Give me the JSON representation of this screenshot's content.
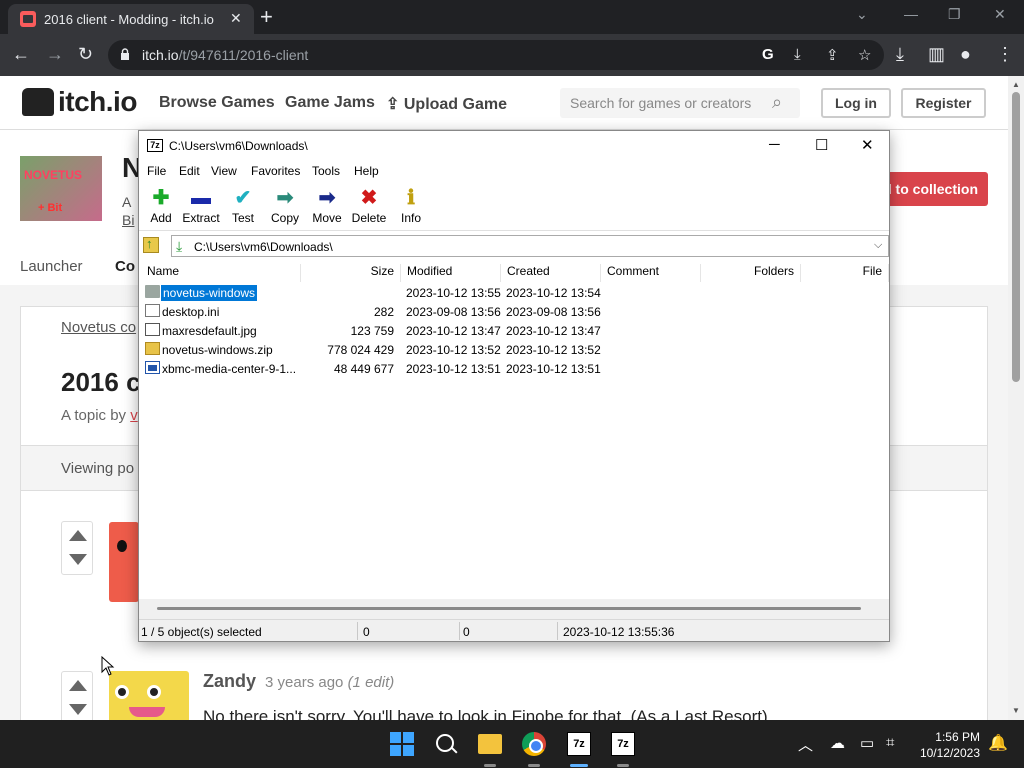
{
  "browser": {
    "tab_title": "2016 client - Modding - itch.io",
    "tab_close": "✕",
    "new_tab": "+",
    "url_host": "itch.io",
    "url_path": "/t/947611/2016-client",
    "win_minimize": "—",
    "win_restore": "❐",
    "win_close": "✕",
    "tab_search": "⌄"
  },
  "site": {
    "logo": "itch.io",
    "nav": [
      "Browse Games",
      "Game Jams",
      "Upload Game"
    ],
    "search_placeholder": "Search for games or creators",
    "login": "Log in",
    "register": "Register"
  },
  "game": {
    "thumb_text": "NOVETUS",
    "thumb_sub": "+ Bit",
    "title": "N",
    "sub1": "A",
    "sub2": "Bi",
    "collect_label": "d to collection",
    "tabs": [
      "Launcher",
      "Co"
    ]
  },
  "forum": {
    "breadcrumb": "Novetus co",
    "topic_title": "2016 c",
    "topic_by": "A topic by",
    "topic_by_link": "v",
    "viewing": "Viewing po",
    "comment": {
      "author": "Zandy",
      "time": "3 years ago",
      "edit": "(1 edit)",
      "body": "No there isn't sorry. You'll have to look in Finobe for that. (As a Last Resort)"
    }
  },
  "sevenzip": {
    "title": "C:\\Users\\vm6\\Downloads\\",
    "logo": "7z",
    "menu": [
      "File",
      "Edit",
      "View",
      "Favorites",
      "Tools",
      "Help"
    ],
    "tools": [
      {
        "label": "Add",
        "icon": "plus-icon",
        "glyph": "✚",
        "color": "#1aaa2a"
      },
      {
        "label": "Extract",
        "icon": "minus-icon",
        "glyph": "▬",
        "color": "#1a2aaa"
      },
      {
        "label": "Test",
        "icon": "check-icon",
        "glyph": "✔",
        "color": "#20b0c0"
      },
      {
        "label": "Copy",
        "icon": "copy-arrow-icon",
        "glyph": "➡",
        "color": "#2a8a7a"
      },
      {
        "label": "Move",
        "icon": "move-arrow-icon",
        "glyph": "➡",
        "color": "#1a2a8a"
      },
      {
        "label": "Delete",
        "icon": "delete-icon",
        "glyph": "✖",
        "color": "#d01a1a"
      },
      {
        "label": "Info",
        "icon": "info-icon",
        "glyph": "ℹ",
        "color": "#c0a010"
      }
    ],
    "address": "C:\\Users\\vm6\\Downloads\\",
    "columns": [
      "Name",
      "Size",
      "Modified",
      "Created",
      "Comment",
      "Folders",
      "File"
    ],
    "files": [
      {
        "name": "novetus-windows",
        "size": "",
        "modified": "2023-10-12 13:55",
        "created": "2023-10-12 13:54",
        "type": "folder",
        "selected": true
      },
      {
        "name": "desktop.ini",
        "size": "282",
        "modified": "2023-09-08 13:56",
        "created": "2023-09-08 13:56",
        "type": "ini",
        "selected": false
      },
      {
        "name": "maxresdefault.jpg",
        "size": "123 759",
        "modified": "2023-10-12 13:47",
        "created": "2023-10-12 13:47",
        "type": "jpg",
        "selected": false
      },
      {
        "name": "novetus-windows.zip",
        "size": "778 024 429",
        "modified": "2023-10-12 13:52",
        "created": "2023-10-12 13:52",
        "type": "zip",
        "selected": false
      },
      {
        "name": "xbmc-media-center-9-1...",
        "size": "48 449 677",
        "modified": "2023-10-12 13:51",
        "created": "2023-10-12 13:51",
        "type": "exe",
        "selected": false
      }
    ],
    "status": {
      "selection": "1 / 5 object(s) selected",
      "size": "0",
      "packed": "0",
      "date": "2023-10-12 13:55:36"
    }
  },
  "taskbar": {
    "zip_label_1": "7z",
    "zip_label_2": "7z",
    "tray_chevron": "︿",
    "time": "1:56 PM",
    "date": "10/12/2023"
  }
}
